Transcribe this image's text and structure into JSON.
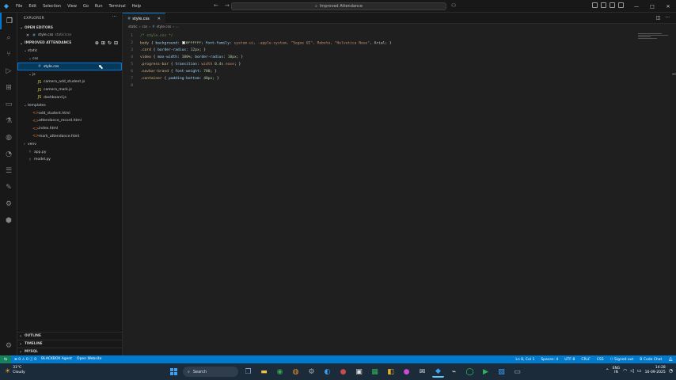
{
  "titlebar": {
    "menu": [
      "File",
      "Edit",
      "Selection",
      "View",
      "Go",
      "Run",
      "Terminal",
      "Help"
    ],
    "search": "Improved Attendance"
  },
  "sidebar": {
    "title": "EXPLORER",
    "open_editors": {
      "label": "OPEN EDITORS",
      "items": [
        {
          "name": "style.css",
          "path": "static\\css"
        }
      ]
    },
    "project": {
      "label": "IMPROVED ATTENDANCE",
      "tree": [
        {
          "label": "static",
          "depth": 1,
          "chev": "v",
          "type": "folder"
        },
        {
          "label": "css",
          "depth": 2,
          "chev": "v",
          "type": "folder"
        },
        {
          "label": "style.css",
          "depth": 3,
          "chev": "",
          "type": "css",
          "selected": true
        },
        {
          "label": "js",
          "depth": 2,
          "chev": "v",
          "type": "folder"
        },
        {
          "label": "camera_add_student.js",
          "depth": 3,
          "chev": "",
          "type": "js"
        },
        {
          "label": "camera_mark.js",
          "depth": 3,
          "chev": "",
          "type": "js"
        },
        {
          "label": "dashboard.js",
          "depth": 3,
          "chev": "",
          "type": "js"
        },
        {
          "label": "templates",
          "depth": 1,
          "chev": "v",
          "type": "folder"
        },
        {
          "label": "add_student.html",
          "depth": 2,
          "chev": "",
          "type": "html"
        },
        {
          "label": "attendance_record.html",
          "depth": 2,
          "chev": "",
          "type": "html"
        },
        {
          "label": "index.html",
          "depth": 2,
          "chev": "",
          "type": "html"
        },
        {
          "label": "mark_attendance.html",
          "depth": 2,
          "chev": "",
          "type": "html"
        },
        {
          "label": "venv",
          "depth": 1,
          "chev": ">",
          "type": "folder"
        },
        {
          "label": "app.py",
          "depth": 1,
          "chev": "",
          "type": "py"
        },
        {
          "label": "model.py",
          "depth": 1,
          "chev": "",
          "type": "py"
        }
      ]
    },
    "bottom_sections": [
      "OUTLINE",
      "TIMELINE",
      "MYSQL"
    ]
  },
  "tab": {
    "label": "style.css"
  },
  "breadcrumb": [
    "static",
    "css",
    "style.css",
    "..."
  ],
  "editor": {
    "lines": [
      {
        "n": "1",
        "parts": [
          {
            "t": "/* style.css */",
            "c": "c-com"
          }
        ]
      },
      {
        "n": "2",
        "parts": [
          {
            "t": "body",
            "c": "c-sel"
          },
          {
            "t": " { ",
            "c": ""
          },
          {
            "t": "background:",
            "c": "c-prop"
          },
          {
            "t": " ",
            "c": ""
          },
          {
            "t": "SWATCH",
            "c": "swatch"
          },
          {
            "t": "#ffffff",
            "c": "c-num"
          },
          {
            "t": "; ",
            "c": ""
          },
          {
            "t": "font-family:",
            "c": "c-prop"
          },
          {
            "t": " system-ui, -apple-system, ",
            "c": "c-val"
          },
          {
            "t": "\"Segoe UI\"",
            "c": "c-str"
          },
          {
            "t": ", Roboto, ",
            "c": "c-val"
          },
          {
            "t": "\"Helvetica Neue\"",
            "c": "c-str"
          },
          {
            "t": ", Arial; }",
            "c": ""
          }
        ]
      },
      {
        "n": "3",
        "parts": [
          {
            "t": ".card",
            "c": "c-sel"
          },
          {
            "t": " { ",
            "c": ""
          },
          {
            "t": "border-radius:",
            "c": "c-prop"
          },
          {
            "t": " 12px",
            "c": "c-num"
          },
          {
            "t": "; }",
            "c": ""
          }
        ]
      },
      {
        "n": "4",
        "parts": [
          {
            "t": "video",
            "c": "c-sel"
          },
          {
            "t": " { ",
            "c": ""
          },
          {
            "t": "max-width:",
            "c": "c-prop"
          },
          {
            "t": " 100%",
            "c": "c-num"
          },
          {
            "t": "; ",
            "c": ""
          },
          {
            "t": "border-radius:",
            "c": "c-prop"
          },
          {
            "t": " 10px",
            "c": "c-num"
          },
          {
            "t": "; }",
            "c": ""
          }
        ]
      },
      {
        "n": "5",
        "parts": [
          {
            "t": ".progress-bar",
            "c": "c-sel"
          },
          {
            "t": " { ",
            "c": ""
          },
          {
            "t": "transition:",
            "c": "c-prop"
          },
          {
            "t": " width ",
            "c": "c-val"
          },
          {
            "t": "0.4s",
            "c": "c-num"
          },
          {
            "t": " ease",
            "c": "c-val"
          },
          {
            "t": "; }",
            "c": ""
          }
        ]
      },
      {
        "n": "6",
        "parts": [
          {
            "t": ".navbar-brand",
            "c": "c-sel"
          },
          {
            "t": " { ",
            "c": ""
          },
          {
            "t": "font-weight:",
            "c": "c-prop"
          },
          {
            "t": " 700",
            "c": "c-num"
          },
          {
            "t": "; }",
            "c": ""
          }
        ]
      },
      {
        "n": "7",
        "parts": [
          {
            "t": ".container",
            "c": "c-sel"
          },
          {
            "t": " { ",
            "c": ""
          },
          {
            "t": "padding-bottom:",
            "c": "c-prop"
          },
          {
            "t": " 40px",
            "c": "c-num"
          },
          {
            "t": "; }",
            "c": ""
          }
        ]
      },
      {
        "n": "8",
        "parts": []
      }
    ]
  },
  "statusbar": {
    "errors": "0",
    "warnings": "0",
    "info": "0",
    "python": "BLACKBOX Agent",
    "website": "Open Website",
    "cursor": "Ln 8, Col 1",
    "spaces": "Spaces: 4",
    "encoding": "UTF-8",
    "eol": "CRLF",
    "lang": "CSS",
    "account": "Signed out",
    "chat": "B Code Chat"
  },
  "taskbar": {
    "temp": "31°C",
    "weather": "Cloudy",
    "search": "Search",
    "lang1": "ENG",
    "lang2": "IN",
    "time": "14:28",
    "date": "16-09-2025"
  }
}
